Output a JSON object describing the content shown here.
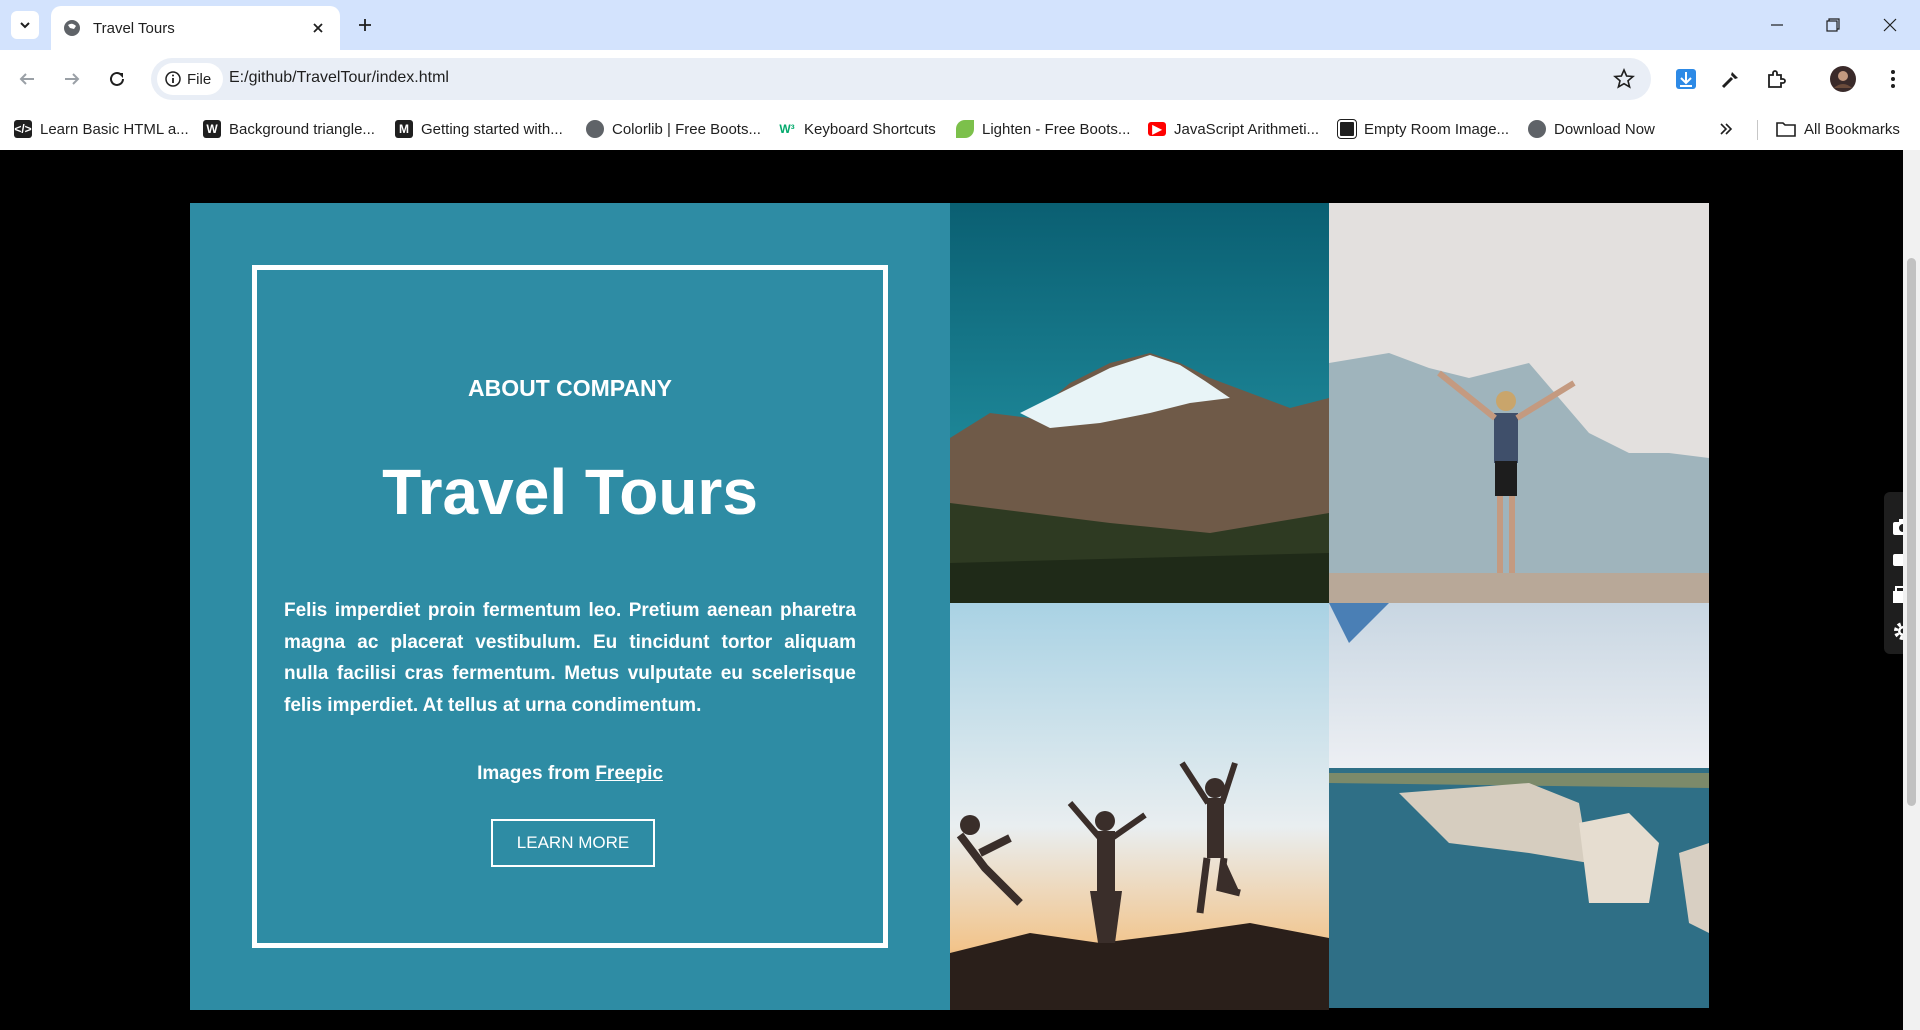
{
  "browser": {
    "tab_title": "Travel Tours",
    "site_chip": "File",
    "url": "E:/github/TravelTour/index.html",
    "bookmarks": [
      {
        "label": "Learn Basic HTML a...",
        "icon": "code-icon"
      },
      {
        "label": "Background triangle...",
        "icon": "w-icon"
      },
      {
        "label": "Getting started with...",
        "icon": "m-icon"
      },
      {
        "label": "Colorlib | Free Boots...",
        "icon": "globe-icon"
      },
      {
        "label": "Keyboard Shortcuts",
        "icon": "w3-icon"
      },
      {
        "label": "Lighten - Free Boots...",
        "icon": "leaf-icon"
      },
      {
        "label": "JavaScript Arithmeti...",
        "icon": "youtube-icon"
      },
      {
        "label": "Empty Room Image...",
        "icon": "square-icon"
      },
      {
        "label": "Download Now",
        "icon": "globe-icon"
      }
    ],
    "all_bookmarks": "All Bookmarks"
  },
  "page": {
    "about_heading": "ABOUT COMPANY",
    "title": "Travel Tours",
    "description": "Felis imperdiet proin fermentum leo. Pretium aenean pharetra magna ac placerat vestibulum. Eu tincidunt tortor aliquam nulla facilisi cras fermentum. Metus vulputate eu scelerisque felis imperdiet. At tellus at urna condimentum.",
    "credit_prefix": "Images from",
    "credit_link": "Freepic",
    "button_label": "LEARN MORE"
  },
  "colors": {
    "panel": "#2e8ca4",
    "tabbar": "#d3e3fd"
  }
}
